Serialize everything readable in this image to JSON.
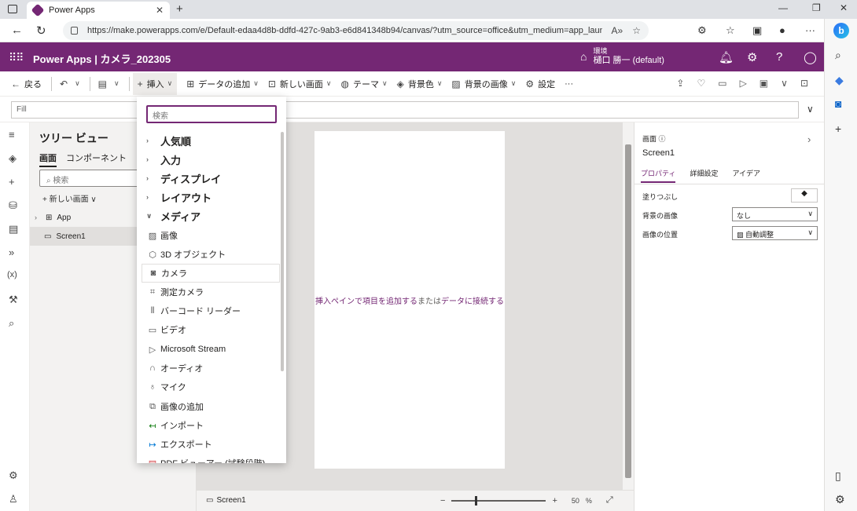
{
  "browser": {
    "tab_title": "Power Apps",
    "url": "https://make.powerapps.com/e/Default-edaa4d8b-ddfd-427c-9ab3-e6d841348b94/canvas/?utm_source=office&utm_medium=app_launcher&utm_..."
  },
  "header": {
    "app_title": "Power Apps | カメラ_202305",
    "env_label": "環境",
    "env_name": "樋口 勝一 (default)"
  },
  "commands": {
    "back": "戻る",
    "insert": "挿入",
    "add_data": "データの追加",
    "new_screen": "新しい画面",
    "theme": "テーマ",
    "background_color": "背景色",
    "background_image": "背景の画像",
    "settings": "設定",
    "more": "···"
  },
  "formula": {
    "property": "Fill"
  },
  "tree": {
    "title": "ツリー ビュー",
    "tabs": [
      "画面",
      "コンポーネント"
    ],
    "search_placeholder": "検索",
    "new_screen": "新しい画面",
    "items": [
      "App",
      "Screen1"
    ]
  },
  "insert_menu": {
    "search_placeholder": "検索",
    "categories": [
      "人気順",
      "入力",
      "ディスプレイ",
      "レイアウト",
      "メディア"
    ],
    "media_items": [
      "画像",
      "3D オブジェクト",
      "カメラ",
      "測定カメラ",
      "バーコード リーダー",
      "ビデオ",
      "Microsoft Stream",
      "オーディオ",
      "マイク",
      "画像の追加",
      "インポート",
      "エクスポート",
      "PDF ビューアー (試験段階)"
    ]
  },
  "canvas": {
    "hint_part1": "挿入ペインで項目を追加する",
    "hint_part2": "または",
    "hint_part3": "データに接続する"
  },
  "status": {
    "screen": "Screen1",
    "zoom": "50",
    "zoom_unit": "%"
  },
  "properties": {
    "type": "画面",
    "name": "Screen1",
    "tabs": [
      "プロパティ",
      "詳細設定",
      "アイデア"
    ],
    "fill_label": "塗りつぶし",
    "bg_image_label": "背景の画像",
    "bg_image_value": "なし",
    "image_position_label": "画像の位置",
    "image_position_value": "自動調整"
  }
}
